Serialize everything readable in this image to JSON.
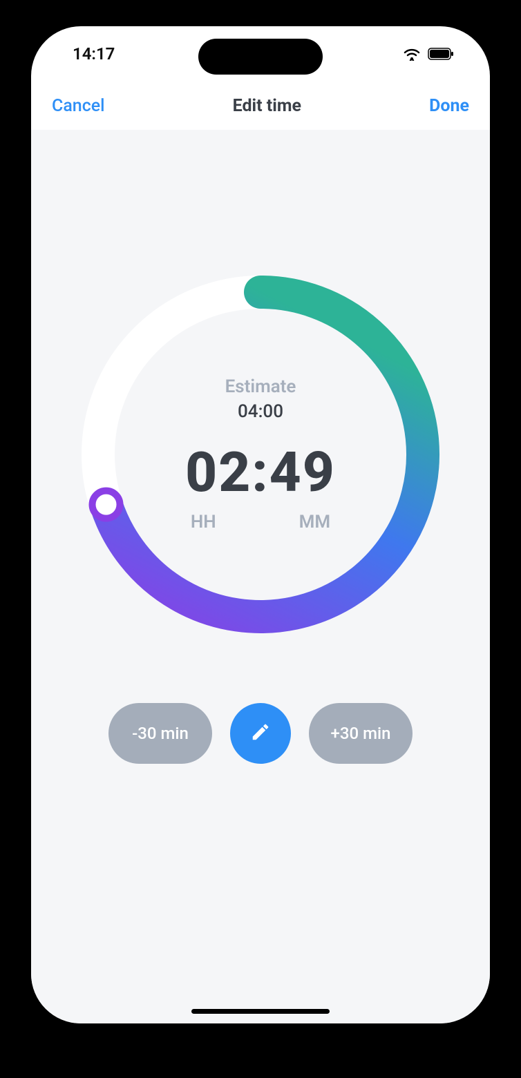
{
  "status": {
    "time": "14:17"
  },
  "nav": {
    "cancel": "Cancel",
    "title": "Edit time",
    "done": "Done"
  },
  "dial": {
    "estimate_label": "Estimate",
    "estimate_value": "04:00",
    "time_value": "02:49",
    "unit_hours": "HH",
    "unit_minutes": "MM",
    "progress_fraction": 0.7
  },
  "buttons": {
    "minus": "-30 min",
    "plus": "+30 min"
  },
  "colors": {
    "accent": "#2e8ff6",
    "gradient_start": "#2db397",
    "gradient_mid": "#3f78ee",
    "gradient_end": "#8a3fe5",
    "pill": "#a4adba",
    "muted": "#a6afbc",
    "dark": "#3a3f47"
  }
}
